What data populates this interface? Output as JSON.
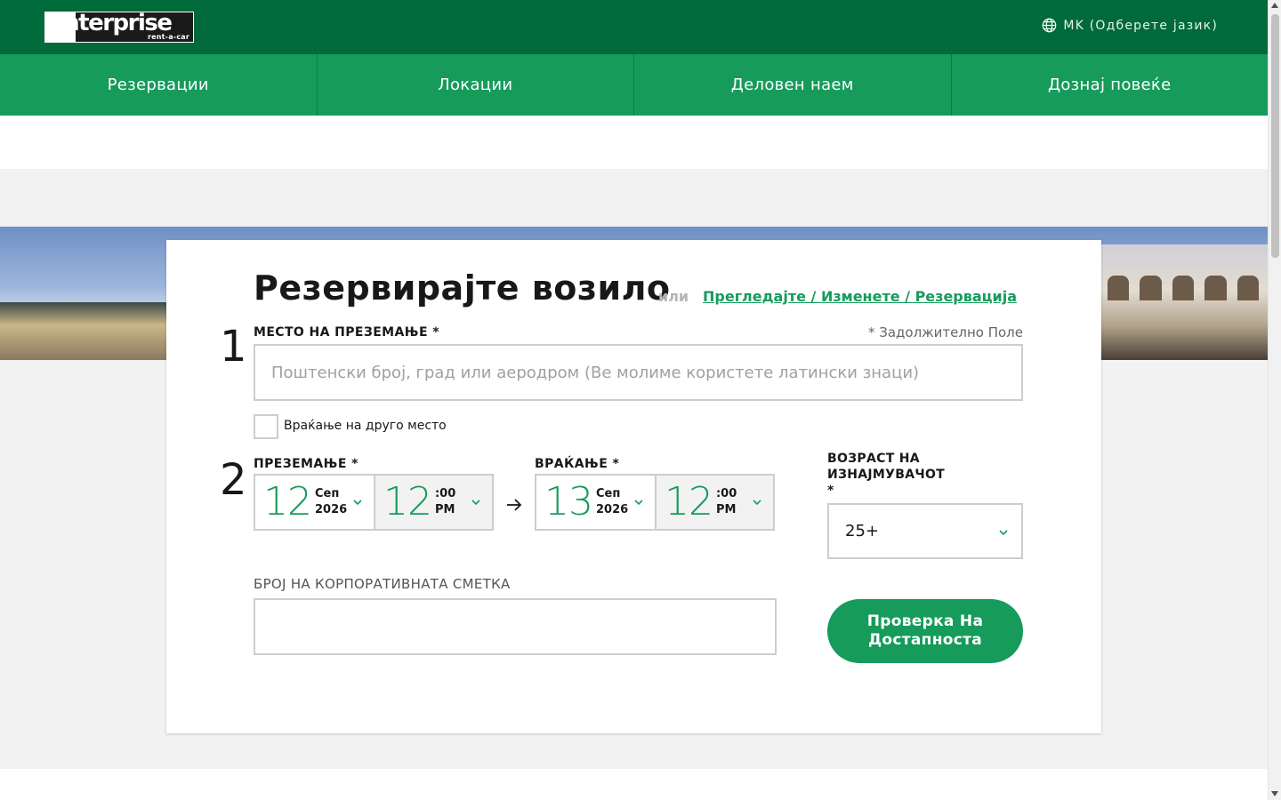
{
  "header": {
    "logo_text": "enterprise",
    "logo_subtext": "rent-a-car",
    "language_label": "MK (Одберете јазик)",
    "language_icon": "globe-icon"
  },
  "nav": {
    "items": [
      {
        "label": "Резервации"
      },
      {
        "label": "Локации"
      },
      {
        "label": "Деловен наем"
      },
      {
        "label": "Дознај повеќе"
      }
    ]
  },
  "booking": {
    "title": "Резервирајте возило",
    "or_text": "или",
    "view_modify_link": "Прегледајте / Изменете / Резервација",
    "required_note": "* Задолжително Поле",
    "step1": "1",
    "step2": "2",
    "pickup_location_label": "МЕСТО НА ПРЕЗЕМАЊЕ *",
    "pickup_location_placeholder": "Поштенски број, град или аеродром (Ве молиме користете латински знаци)",
    "return_other_label": "Враќање на друго место",
    "pickup_label": "ПРЕЗЕМАЊЕ *",
    "pickup_date": {
      "day": "12",
      "month": "Сеп",
      "year": "2026"
    },
    "pickup_time": {
      "hour": "12",
      "minutes": ":00",
      "ampm": "PM"
    },
    "return_label": "ВРАЌАЊЕ *",
    "return_date": {
      "day": "13",
      "month": "Сеп",
      "year": "2026"
    },
    "return_time": {
      "hour": "12",
      "minutes": ":00",
      "ampm": "PM"
    },
    "age_label": "ВОЗРАСТ НА ИЗНАЈМУВАЧОТ",
    "age_required": "*",
    "age_value": "25+",
    "corporate_label": "БРОЈ НА КОРПОРАТИВНАТА СМЕТКА",
    "corporate_value": "",
    "submit_label": "Проверка На Достапноста"
  },
  "colors": {
    "header_dark_green": "#006a3a",
    "nav_green": "#169b5b",
    "accent_green": "#169b5b",
    "page_grey": "#f2f2f2"
  }
}
